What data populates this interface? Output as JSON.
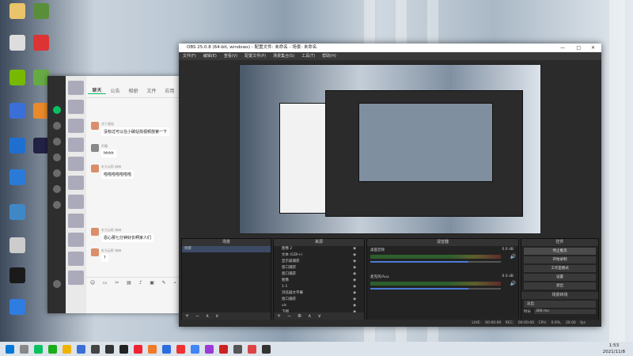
{
  "desktop": {
    "icons": [
      "",
      "",
      "",
      "",
      "",
      "",
      "",
      "",
      "",
      "",
      "",
      ""
    ]
  },
  "chat": {
    "tabs": [
      "聊天",
      "公告",
      "相册",
      "文件",
      "应用"
    ],
    "messages": [
      {
        "name": "浓于墨烟",
        "text": "没标过可以在小破站找视频放第一下"
      },
      {
        "name": "阿瞳",
        "text": "hhhh"
      },
      {
        "name": "虹光云影 麻麻",
        "text": "啦啦啦啦啦啦啦"
      },
      {
        "name": "虹光云影 麻麻",
        "text": "恩心那七分钟好长啊家人们"
      },
      {
        "name": "虹光云影 麻麻",
        "text": "?"
      }
    ],
    "toolbar_icons": [
      "☺",
      "▭",
      "✂",
      "▤",
      "♪",
      "▣",
      "✎",
      "⌁"
    ]
  },
  "obs": {
    "title": "OBS 25.0.8 (64-bit, windows) - 配置文件: 未命名 - 场景: 未命名",
    "window_buttons": [
      "—",
      "□",
      "✕"
    ],
    "menu": [
      "文件(F)",
      "编辑(E)",
      "查看(V)",
      "配置文件(P)",
      "场景集合(S)",
      "工具(T)",
      "帮助(H)"
    ],
    "scenes": {
      "header": "场景",
      "items": [
        "场景"
      ],
      "footer": "+ − ∧ ∨"
    },
    "sources": {
      "header": "来源",
      "items": [
        "图像 2",
        "文本 (GDI+)",
        "显示器捕获",
        "窗口捕获",
        "窗口捕获",
        "图像",
        "1-1",
        "浏览器文字幕",
        "窗口捕获",
        "vlc",
        "下图"
      ],
      "footer": "+ − ⚙ ∧ ∨"
    },
    "mixer": {
      "header": "混音器",
      "tracks": [
        {
          "name": "桌面音频",
          "db": "0.0 dB",
          "level": 0.75
        },
        {
          "name": "麦克风/Aux",
          "db": "0.0 dB",
          "level": 0.75
        }
      ]
    },
    "controls": {
      "header": "控件",
      "buttons": [
        "停止推流",
        "开始录制",
        "工作室模式",
        "设置",
        "退出"
      ],
      "transitions_header": "场景转场",
      "transition": "淡出",
      "duration_label": "时长",
      "duration": "300 ms"
    },
    "status": [
      "LIVE: 00:00:00",
      "REC: 00:00:00",
      "CPU: 0.9%, 30.00 fps"
    ]
  },
  "taskbar": {
    "time": "1:53",
    "date": "2021/11/8"
  },
  "colors": {
    "accent": "#07c160",
    "obs_bg": "#2b2b2b",
    "selection": "#3c4a66"
  }
}
